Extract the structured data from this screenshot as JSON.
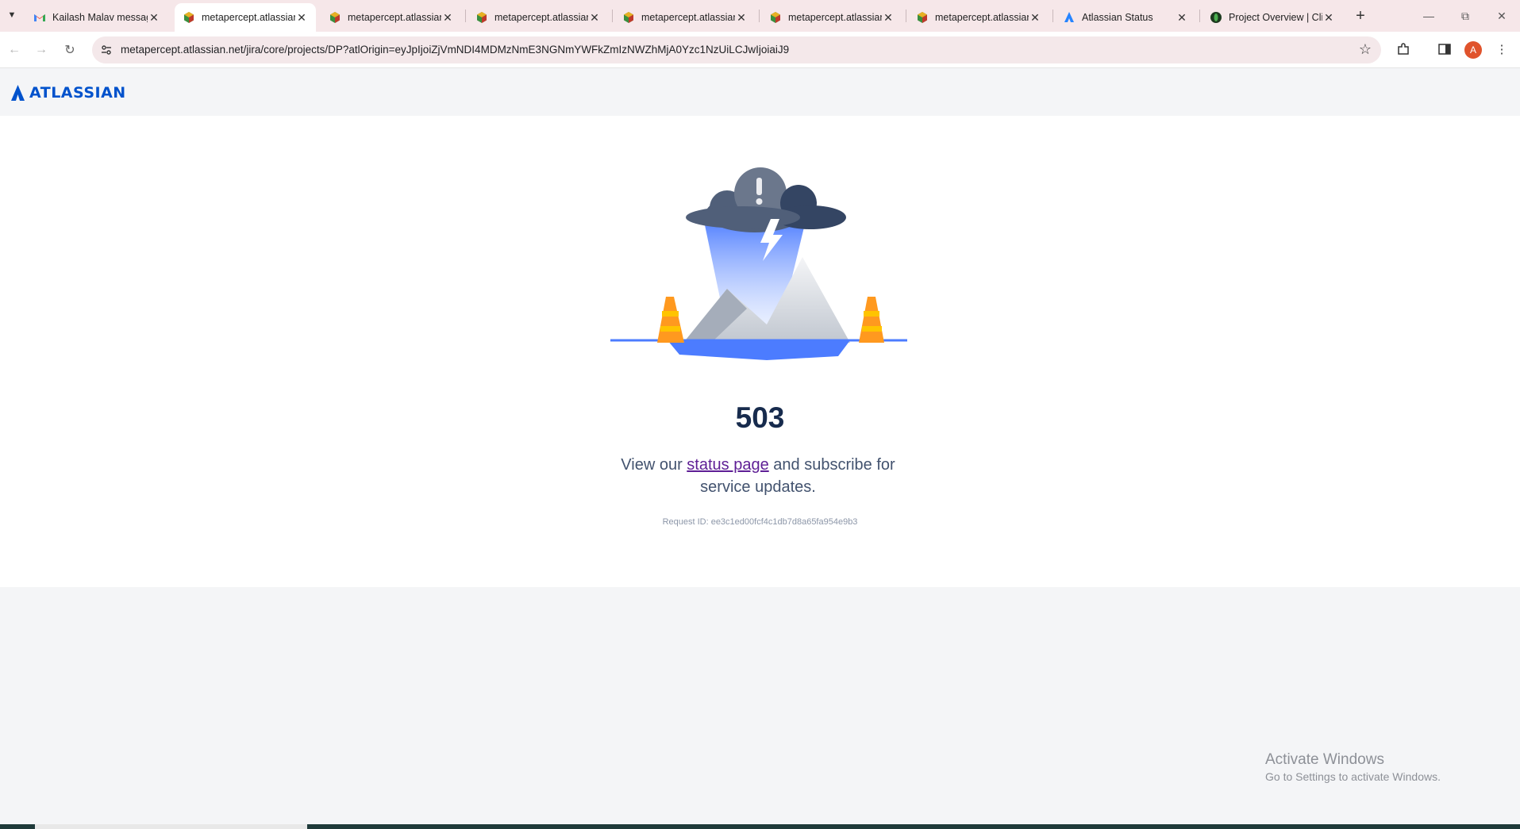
{
  "browser": {
    "tabs": [
      {
        "title": "Kailash Malav messag",
        "icon": "gmail-icon",
        "active": false
      },
      {
        "title": "metapercept.atlassian",
        "icon": "atlassian-site-icon",
        "active": true
      },
      {
        "title": "metapercept.atlassian",
        "icon": "atlassian-site-icon",
        "active": false
      },
      {
        "title": "metapercept.atlassian",
        "icon": "atlassian-site-icon",
        "active": false
      },
      {
        "title": "metapercept.atlassian",
        "icon": "atlassian-site-icon",
        "active": false
      },
      {
        "title": "metapercept.atlassian",
        "icon": "atlassian-site-icon",
        "active": false
      },
      {
        "title": "metapercept.atlassian",
        "icon": "atlassian-site-icon",
        "active": false
      },
      {
        "title": "Atlassian Status",
        "icon": "atlassian-icon",
        "active": false
      },
      {
        "title": "Project Overview | Cli",
        "icon": "project-icon",
        "active": false
      }
    ],
    "url": "metapercept.atlassian.net/jira/core/projects/DP?atlOrigin=eyJpIjoiZjVmNDI4MDMzNmE3NGNmYWFkZmIzNWZhMjA0Yzc1NzUiLCJwIjoiaiJ9",
    "profile_initial": "A"
  },
  "page": {
    "brand": "ATLASSIAN",
    "error_code": "503",
    "message_before": "View our ",
    "status_link": "status page",
    "message_after": " and subscribe for service updates.",
    "request_id": "Request ID: ee3c1ed00fcf4c1db7d8a65fa954e9b3"
  },
  "os": {
    "watermark_title": "Activate Windows",
    "watermark_sub": "Go to Settings to activate Windows."
  },
  "colors": {
    "brand_blue": "#0052cc",
    "heading": "#172b4d",
    "link_visited": "#5e1e95",
    "tabstrip_bg": "#f6e7e9"
  }
}
